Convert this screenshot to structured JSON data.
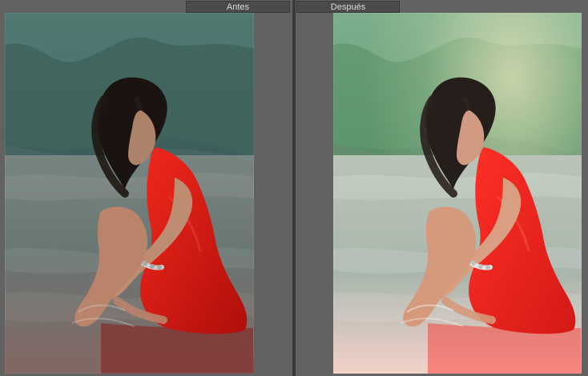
{
  "compare": {
    "before_label": "Antes",
    "after_label": "Después"
  },
  "colors": {
    "workspace_bg": "#5f5f5f",
    "label_bg": "#4b4b4b",
    "label_text": "#d9d9d9",
    "divider": "#3a3a3a"
  }
}
